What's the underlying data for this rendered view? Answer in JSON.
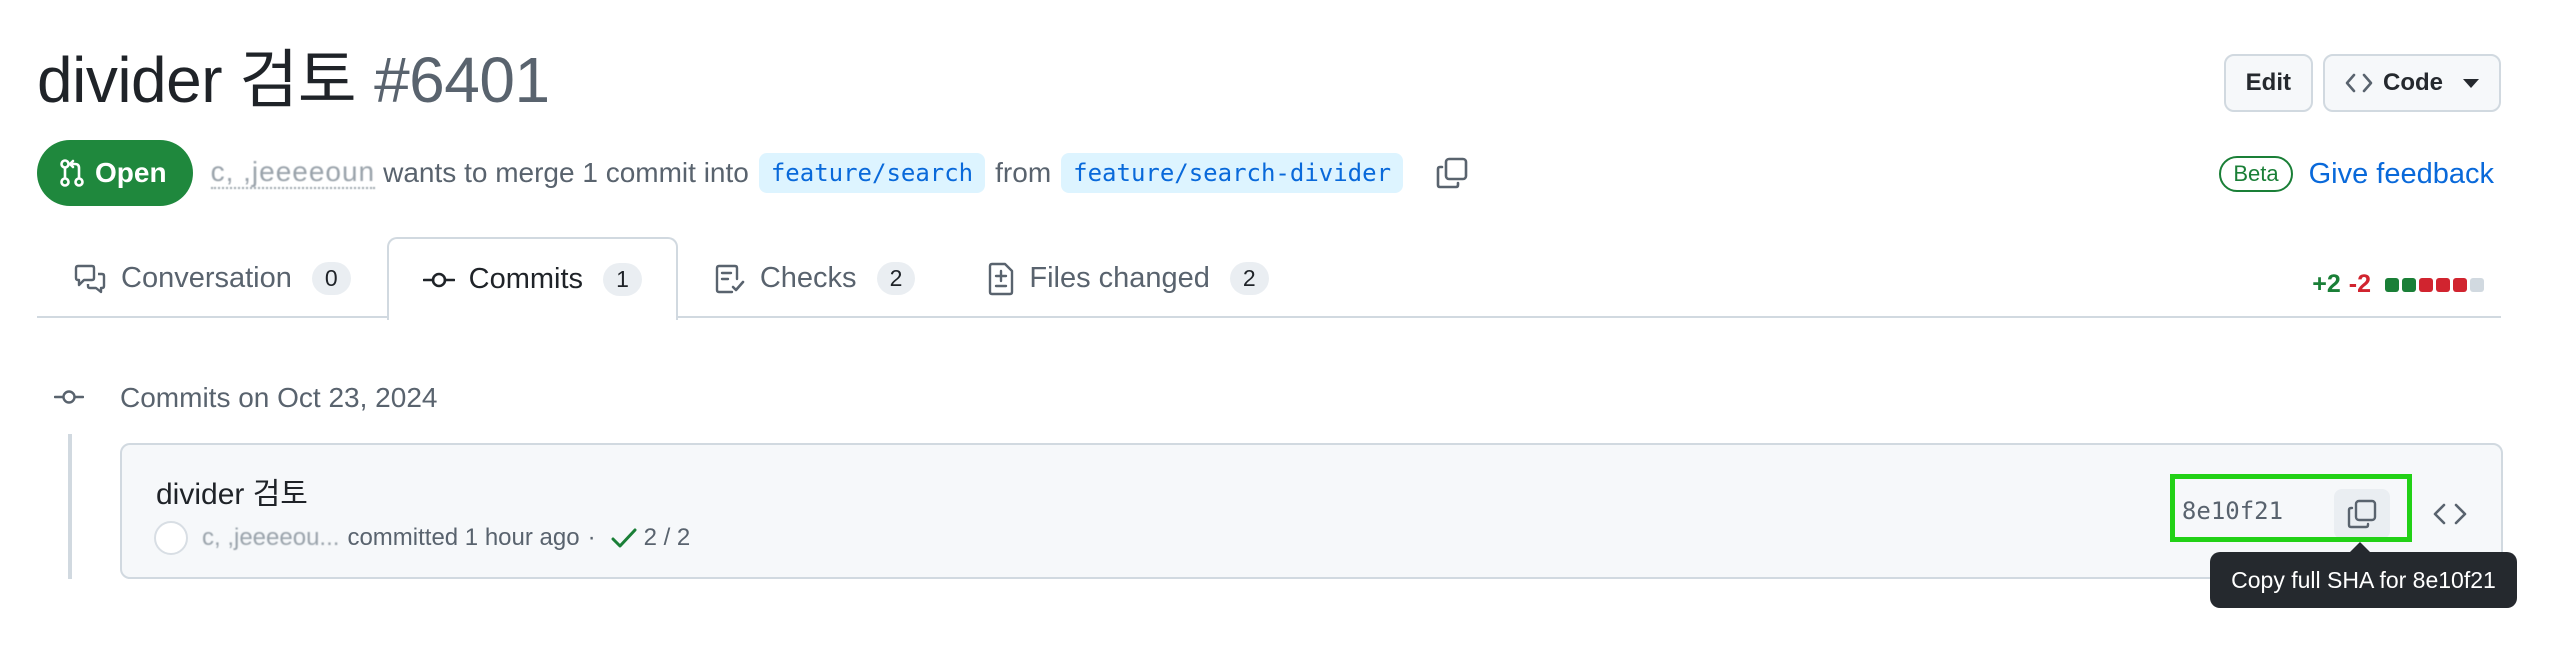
{
  "header": {
    "title": "divider 검토",
    "number": "#6401",
    "edit_label": "Edit",
    "code_label": "Code"
  },
  "state": {
    "label": "Open",
    "author": "c, ,jeeeeoun",
    "merge_text": "wants to merge 1 commit into",
    "base_branch": "feature/search",
    "from_text": "from",
    "head_branch": "feature/search-divider"
  },
  "feedback": {
    "beta_label": "Beta",
    "link_label": "Give feedback"
  },
  "tabs": [
    {
      "label": "Conversation",
      "count": "0",
      "icon": "comment-discussion-icon"
    },
    {
      "label": "Commits",
      "count": "1",
      "icon": "git-commit-icon"
    },
    {
      "label": "Checks",
      "count": "2",
      "icon": "checklist-icon"
    },
    {
      "label": "Files changed",
      "count": "2",
      "icon": "file-diff-icon"
    }
  ],
  "selected_tab": "Commits",
  "diffstat": {
    "additions": "+2",
    "deletions": "-2",
    "blocks": [
      "#1a7f37",
      "#1a7f37",
      "#d1242f",
      "#d1242f",
      "#d1242f",
      "#d1d9e0"
    ]
  },
  "commits": {
    "group_title": "Commits on Oct 23, 2024",
    "items": [
      {
        "title": "divider 검토",
        "author": "c, ,jeeeeou...",
        "committed_text": "committed 1 hour ago",
        "separator": "·",
        "checks": "2 / 2",
        "sha": "8e10f21"
      }
    ]
  },
  "tooltip": {
    "text": "Copy full SHA for 8e10f21"
  },
  "colors": {
    "open_green": "#1f883d",
    "link_blue": "#0969da",
    "highlight": "#22d116"
  }
}
